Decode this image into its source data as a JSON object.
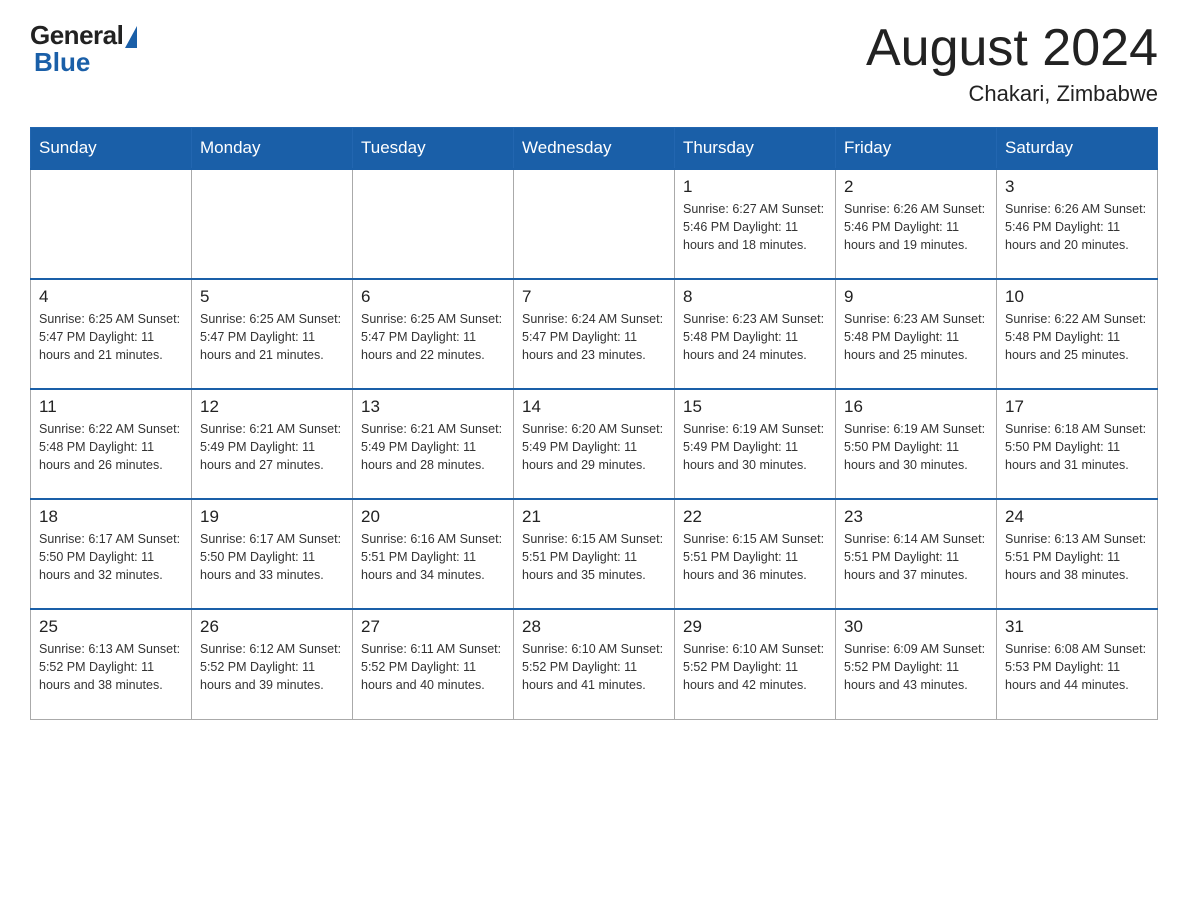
{
  "logo": {
    "general": "General",
    "blue": "Blue",
    "subtitle": ""
  },
  "header": {
    "month_year": "August 2024",
    "location": "Chakari, Zimbabwe"
  },
  "weekdays": [
    "Sunday",
    "Monday",
    "Tuesday",
    "Wednesday",
    "Thursday",
    "Friday",
    "Saturday"
  ],
  "weeks": [
    [
      {
        "day": "",
        "info": ""
      },
      {
        "day": "",
        "info": ""
      },
      {
        "day": "",
        "info": ""
      },
      {
        "day": "",
        "info": ""
      },
      {
        "day": "1",
        "info": "Sunrise: 6:27 AM\nSunset: 5:46 PM\nDaylight: 11 hours\nand 18 minutes."
      },
      {
        "day": "2",
        "info": "Sunrise: 6:26 AM\nSunset: 5:46 PM\nDaylight: 11 hours\nand 19 minutes."
      },
      {
        "day": "3",
        "info": "Sunrise: 6:26 AM\nSunset: 5:46 PM\nDaylight: 11 hours\nand 20 minutes."
      }
    ],
    [
      {
        "day": "4",
        "info": "Sunrise: 6:25 AM\nSunset: 5:47 PM\nDaylight: 11 hours\nand 21 minutes."
      },
      {
        "day": "5",
        "info": "Sunrise: 6:25 AM\nSunset: 5:47 PM\nDaylight: 11 hours\nand 21 minutes."
      },
      {
        "day": "6",
        "info": "Sunrise: 6:25 AM\nSunset: 5:47 PM\nDaylight: 11 hours\nand 22 minutes."
      },
      {
        "day": "7",
        "info": "Sunrise: 6:24 AM\nSunset: 5:47 PM\nDaylight: 11 hours\nand 23 minutes."
      },
      {
        "day": "8",
        "info": "Sunrise: 6:23 AM\nSunset: 5:48 PM\nDaylight: 11 hours\nand 24 minutes."
      },
      {
        "day": "9",
        "info": "Sunrise: 6:23 AM\nSunset: 5:48 PM\nDaylight: 11 hours\nand 25 minutes."
      },
      {
        "day": "10",
        "info": "Sunrise: 6:22 AM\nSunset: 5:48 PM\nDaylight: 11 hours\nand 25 minutes."
      }
    ],
    [
      {
        "day": "11",
        "info": "Sunrise: 6:22 AM\nSunset: 5:48 PM\nDaylight: 11 hours\nand 26 minutes."
      },
      {
        "day": "12",
        "info": "Sunrise: 6:21 AM\nSunset: 5:49 PM\nDaylight: 11 hours\nand 27 minutes."
      },
      {
        "day": "13",
        "info": "Sunrise: 6:21 AM\nSunset: 5:49 PM\nDaylight: 11 hours\nand 28 minutes."
      },
      {
        "day": "14",
        "info": "Sunrise: 6:20 AM\nSunset: 5:49 PM\nDaylight: 11 hours\nand 29 minutes."
      },
      {
        "day": "15",
        "info": "Sunrise: 6:19 AM\nSunset: 5:49 PM\nDaylight: 11 hours\nand 30 minutes."
      },
      {
        "day": "16",
        "info": "Sunrise: 6:19 AM\nSunset: 5:50 PM\nDaylight: 11 hours\nand 30 minutes."
      },
      {
        "day": "17",
        "info": "Sunrise: 6:18 AM\nSunset: 5:50 PM\nDaylight: 11 hours\nand 31 minutes."
      }
    ],
    [
      {
        "day": "18",
        "info": "Sunrise: 6:17 AM\nSunset: 5:50 PM\nDaylight: 11 hours\nand 32 minutes."
      },
      {
        "day": "19",
        "info": "Sunrise: 6:17 AM\nSunset: 5:50 PM\nDaylight: 11 hours\nand 33 minutes."
      },
      {
        "day": "20",
        "info": "Sunrise: 6:16 AM\nSunset: 5:51 PM\nDaylight: 11 hours\nand 34 minutes."
      },
      {
        "day": "21",
        "info": "Sunrise: 6:15 AM\nSunset: 5:51 PM\nDaylight: 11 hours\nand 35 minutes."
      },
      {
        "day": "22",
        "info": "Sunrise: 6:15 AM\nSunset: 5:51 PM\nDaylight: 11 hours\nand 36 minutes."
      },
      {
        "day": "23",
        "info": "Sunrise: 6:14 AM\nSunset: 5:51 PM\nDaylight: 11 hours\nand 37 minutes."
      },
      {
        "day": "24",
        "info": "Sunrise: 6:13 AM\nSunset: 5:51 PM\nDaylight: 11 hours\nand 38 minutes."
      }
    ],
    [
      {
        "day": "25",
        "info": "Sunrise: 6:13 AM\nSunset: 5:52 PM\nDaylight: 11 hours\nand 38 minutes."
      },
      {
        "day": "26",
        "info": "Sunrise: 6:12 AM\nSunset: 5:52 PM\nDaylight: 11 hours\nand 39 minutes."
      },
      {
        "day": "27",
        "info": "Sunrise: 6:11 AM\nSunset: 5:52 PM\nDaylight: 11 hours\nand 40 minutes."
      },
      {
        "day": "28",
        "info": "Sunrise: 6:10 AM\nSunset: 5:52 PM\nDaylight: 11 hours\nand 41 minutes."
      },
      {
        "day": "29",
        "info": "Sunrise: 6:10 AM\nSunset: 5:52 PM\nDaylight: 11 hours\nand 42 minutes."
      },
      {
        "day": "30",
        "info": "Sunrise: 6:09 AM\nSunset: 5:52 PM\nDaylight: 11 hours\nand 43 minutes."
      },
      {
        "day": "31",
        "info": "Sunrise: 6:08 AM\nSunset: 5:53 PM\nDaylight: 11 hours\nand 44 minutes."
      }
    ]
  ]
}
